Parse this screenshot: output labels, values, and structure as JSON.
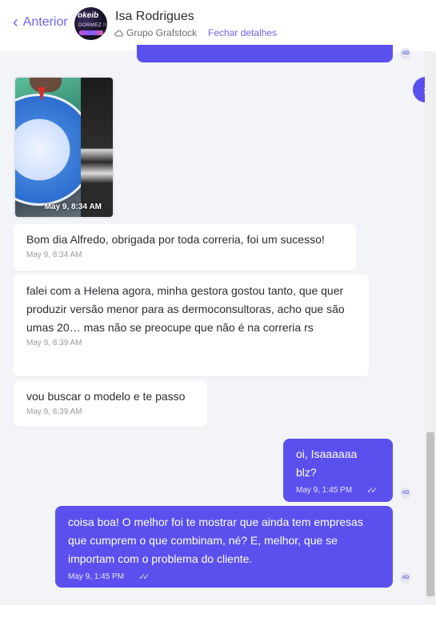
{
  "header": {
    "back_label": "Anterior",
    "contact_name": "Isa Rodrigues",
    "group_name": "Grupo Grafstock",
    "details_link": "Fechar detalhes",
    "avatar_text": "okeib",
    "avatar_subtext": "DORMEZ !!"
  },
  "messages": [
    {
      "type": "image",
      "time": "May 9, 8:34 AM"
    },
    {
      "type": "in",
      "text": "Bom dia Alfredo, obrigada por toda correria, foi um sucesso!",
      "time": "May 9, 8:34 AM"
    },
    {
      "type": "in",
      "text": "falei com a Helena agora, minha gestora gostou tanto, que quer produzir versão menor para as dermoconsultoras, acho que são umas 20… mas não se preocupe que não é na correria rs",
      "time": "May 9, 8:39 AM"
    },
    {
      "type": "in",
      "text": "vou buscar o modelo e te passo",
      "time": "May 9, 8:39 AM"
    },
    {
      "type": "out",
      "text": "oi, Isaaaaaa blz?",
      "time": "May 9, 1:45 PM",
      "avatar": "AD"
    },
    {
      "type": "out",
      "text": "coisa boa! O melhor foi te mostrar que ainda tem empresas que cumprem o que combinam, né? E, melhor, que se importam com o problema do cliente.",
      "time": "May 9, 1:45 PM",
      "avatar": "AD"
    }
  ],
  "top_avatar": "AD",
  "colors": {
    "accent": "#5b50ee",
    "link": "#6b64f0",
    "bg": "#f3f4f8"
  }
}
